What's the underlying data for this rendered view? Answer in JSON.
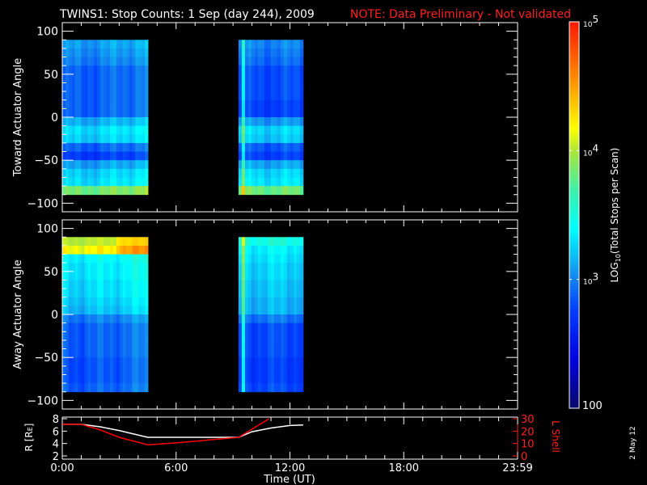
{
  "title": "TWINS1: Stop Counts:  1 Sep (day 244), 2009",
  "note": "NOTE: Data Preliminary - Not validated",
  "side_date": "2 May 12",
  "colors": {
    "note": "#ff0000",
    "lshell": "#ff0000",
    "radius": "#ffffff"
  },
  "chart_data": [
    {
      "type": "heatmap",
      "name": "toward",
      "ylabel": "Toward Actuator Angle",
      "ylim": [
        -110,
        110
      ],
      "yticks": [
        "100",
        "50",
        "0",
        "−50",
        "−100"
      ],
      "ytick_values": [
        100,
        50,
        0,
        -50,
        -100
      ],
      "angle_bins": [
        85,
        75,
        65,
        55,
        45,
        35,
        25,
        15,
        5,
        -5,
        -15,
        -25,
        -35,
        -45,
        -55,
        -65,
        -75,
        -85
      ],
      "intervals": [
        {
          "start_h": 0.0,
          "end_h": 4.52,
          "log10_counts": [
            3.05,
            3.0,
            2.95,
            2.85,
            2.85,
            2.85,
            2.85,
            2.85,
            2.85,
            3.1,
            3.25,
            3.2,
            2.85,
            2.7,
            3.05,
            3.2,
            3.25,
            3.8
          ]
        },
        {
          "start_h": 9.29,
          "end_h": 12.7,
          "log10_counts": [
            3.0,
            2.95,
            2.9,
            2.8,
            2.8,
            2.8,
            2.8,
            2.75,
            2.75,
            3.05,
            3.25,
            3.2,
            2.85,
            2.75,
            3.1,
            3.25,
            3.3,
            3.8
          ]
        }
      ]
    },
    {
      "type": "heatmap",
      "name": "away",
      "ylabel": "Away Actuator Angle",
      "ylim": [
        -110,
        110
      ],
      "yticks": [
        "100",
        "50",
        "0",
        "−50",
        "−100"
      ],
      "ytick_values": [
        100,
        50,
        0,
        -50,
        -100
      ],
      "angle_bins": [
        85,
        75,
        65,
        55,
        45,
        35,
        25,
        15,
        5,
        -5,
        -15,
        -25,
        -35,
        -45,
        -55,
        -65,
        -75,
        -85
      ],
      "intervals": [
        {
          "start_h": 0.0,
          "end_h": 4.52,
          "log10_counts": [
            4.0,
            4.15,
            3.35,
            3.3,
            3.3,
            3.25,
            3.25,
            3.2,
            3.15,
            2.95,
            2.85,
            2.85,
            2.85,
            2.85,
            2.8,
            2.8,
            2.8,
            2.85
          ]
        },
        {
          "start_h": 9.29,
          "end_h": 12.7,
          "log10_counts": [
            3.5,
            3.35,
            3.3,
            3.25,
            3.25,
            3.2,
            3.2,
            3.15,
            3.15,
            2.95,
            2.8,
            2.8,
            2.8,
            2.8,
            2.75,
            2.75,
            2.75,
            2.8
          ]
        }
      ]
    },
    {
      "type": "line",
      "name": "orbit",
      "xlabel": "Time (UT)",
      "xlim": [
        0,
        24
      ],
      "xticks": [
        "0:00",
        "6:00",
        "12:00",
        "18:00",
        "23:59"
      ],
      "xtick_values": [
        0,
        6,
        12,
        18,
        24
      ],
      "ylabel_left": "R [R",
      "ylabel_left_sub": "E",
      "ylabel_left_end": "]",
      "ylabel_right": "L Shell",
      "ylim_left": [
        2,
        8
      ],
      "ylim_right": [
        0,
        30
      ],
      "yticks_left": [
        "2",
        "4",
        "6",
        "8"
      ],
      "yticks_right": [
        "0",
        "10",
        "20",
        "30"
      ],
      "series": [
        {
          "name": "R",
          "axis": "left",
          "x": [
            0,
            1,
            2,
            3,
            4.5,
            9.3,
            10,
            11,
            12,
            12.7
          ],
          "y": [
            7.1,
            7.1,
            6.7,
            6.1,
            5.0,
            5.0,
            5.9,
            6.5,
            6.9,
            7.0
          ]
        },
        {
          "name": "L Shell",
          "axis": "right",
          "x": [
            0,
            1,
            2,
            3,
            4.5,
            6,
            9.3,
            10.9
          ],
          "y": [
            25.5,
            25.5,
            21,
            15,
            9,
            10.5,
            15,
            30
          ]
        }
      ]
    }
  ],
  "colorbar": {
    "label": "LOG",
    "label_sub": "10",
    "label_rest": "(Total Stops per Scan)",
    "ticks": [
      {
        "base": "10",
        "exp": "5",
        "value": 5
      },
      {
        "base": "10",
        "exp": "4",
        "value": 4
      },
      {
        "base": "10",
        "exp": "3",
        "value": 3
      }
    ],
    "min_label": "100",
    "range_log10": [
      2,
      5
    ]
  }
}
